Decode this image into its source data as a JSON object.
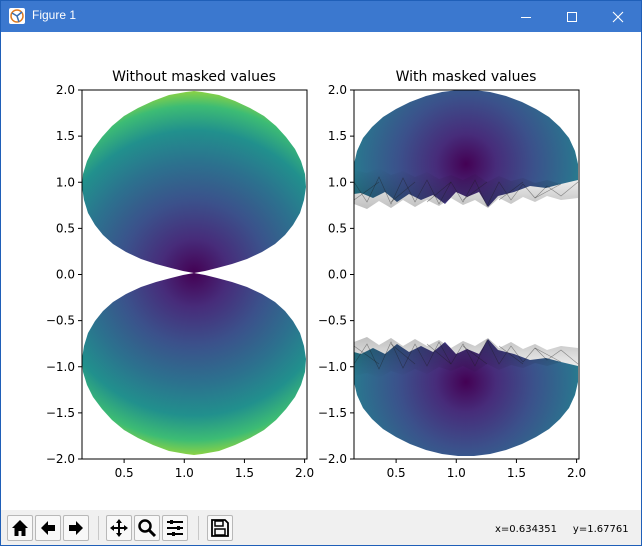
{
  "window": {
    "title": "Figure 1"
  },
  "toolbar": {
    "buttons": [
      {
        "icon": "home-icon",
        "name": "home-button"
      },
      {
        "icon": "back-arrow-icon",
        "name": "back-button"
      },
      {
        "icon": "forward-arrow-icon",
        "name": "forward-button"
      },
      {
        "icon": "move-icon",
        "name": "pan-button"
      },
      {
        "icon": "zoom-icon",
        "name": "zoom-button"
      },
      {
        "icon": "sliders-icon",
        "name": "configure-subplots-button"
      },
      {
        "icon": "save-icon",
        "name": "save-button"
      }
    ],
    "coords_text": "x=0.634351     y=1.67761"
  },
  "chart_data": [
    {
      "type": "tripcolor",
      "title": "Without masked values",
      "xlabel": "",
      "ylabel": "",
      "xlim": [
        0.15,
        2.02
      ],
      "ylim": [
        -2.0,
        2.0
      ],
      "xticks": [
        "0.5",
        "1.0",
        "1.5",
        "2.0"
      ],
      "yticks": [
        "2.0",
        "1.5",
        "1.0",
        "0.5",
        "0.0",
        "−0.5",
        "−1.0",
        "−1.5",
        "−2.0"
      ],
      "colormap": "viridis",
      "regions": [
        {
          "shape": "filled disc",
          "center": [
            1.1,
            1.0
          ],
          "radius_x": 0.93,
          "radius_y": 0.98
        },
        {
          "shape": "filled disc",
          "center": [
            1.1,
            -1.0
          ],
          "radius_x": 0.93,
          "radius_y": 0.98
        }
      ],
      "value_minimum_at": [
        1.1,
        0.0
      ]
    },
    {
      "type": "tripcolor",
      "title": "With masked values",
      "xlabel": "",
      "ylabel": "",
      "xlim": [
        0.15,
        2.02
      ],
      "ylim": [
        -2.0,
        2.0
      ],
      "xticks": [
        "0.5",
        "1.0",
        "1.5",
        "2.0"
      ],
      "yticks": [
        "2.0",
        "1.5",
        "1.0",
        "0.5",
        "0.0",
        "−0.5",
        "−1.0",
        "−1.5",
        "−2.0"
      ],
      "colormap": "viridis",
      "regions": [
        {
          "shape": "cap of disc, masked below y≈1.0",
          "center": [
            1.1,
            1.0
          ],
          "radius_x": 0.93,
          "radius_y": 0.98
        },
        {
          "shape": "cap of disc, masked above y≈−1.0",
          "center": [
            1.1,
            -1.0
          ],
          "radius_x": 0.93,
          "radius_y": 0.98
        }
      ],
      "masked_band_y": [
        -0.95,
        0.95
      ]
    }
  ]
}
